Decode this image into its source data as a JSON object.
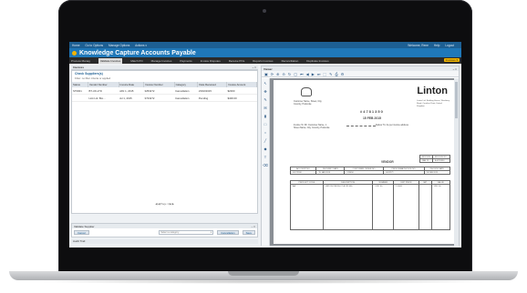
{
  "app": {
    "title": "Knowledge Capture Accounts Payable",
    "top_links": [
      "Home",
      "Go to Options",
      "Manage Options",
      "Actions ▾"
    ],
    "user_links": [
      "Welcome, Rene",
      "Help",
      "Logout"
    ]
  },
  "tabs": [
    {
      "label": "Process Manag"
    },
    {
      "label": "Validate Invoices",
      "active": true
    },
    {
      "label": "Match PO"
    },
    {
      "label": "Manage Invoices"
    },
    {
      "label": "Payments"
    },
    {
      "label": "Invoice Disputes"
    },
    {
      "label": "Receive POs"
    },
    {
      "label": "Reports Invoices"
    },
    {
      "label": "Reconciliation"
    },
    {
      "label": "Duplicate Invoices"
    }
  ],
  "tab_highlight": "Invoices ▾",
  "left_panel": {
    "header": "Invoices",
    "header_controls": "– □",
    "subtitle": "Check Suppliers(s)",
    "filter": "Filter: no filter criteria or applied",
    "columns": [
      "Status",
      "Vendor Number",
      "Invoice Date",
      "Invoice Number",
      "Category",
      "Date Received",
      "Invoice Amount"
    ],
    "rows": [
      [
        "ST0001",
        "BT-UK-LTD",
        "JAN 1, 2015",
        "3253272",
        "Cancellation",
        "23/02/2015",
        "$2000"
      ],
      [
        "",
        "Link Ltd. Bro...",
        "Jul 1, 2015",
        "3723272",
        "Cancellation",
        "Pending",
        "$400.00"
      ]
    ],
    "pager": "◀ ◀ Page 1 ▶ ▶"
  },
  "lower_panel": {
    "header": "Validate Supplier",
    "header_controls": "– □",
    "left_button": "Cancel",
    "select_placeholder": "Select a category",
    "action_button": "Cancellation",
    "save_button": "Save"
  },
  "audit_header": "Audit Trail",
  "viewer": {
    "header": "Viewer",
    "header_controls": "– □",
    "doc": {
      "brand": "Linton",
      "brand_sub": "Linton Ltd. Building House, Westbury Road, Carolina Paint, United Kingdom",
      "address": "Customer Name, Street, City, Country, Postcode",
      "invoice_no": "#4781350",
      "invoice_date": "15 FEB 2015",
      "invoice_to": "Invoice To: Mr. Customer Name, 1 Street Name, City, Country, Postcode",
      "deliver_to": "Deliver To: As per invoice address",
      "vendor_label": "VENDOR",
      "mini1": {
        "headers": [
          "INVOICE",
          "INVOICE NO."
        ],
        "values": [
          "JAN 15",
          "A 4781350"
        ]
      },
      "mini2": {
        "headers": [
          "ACCOUNT NO.",
          "DELIVERY DATE",
          "CUSTOMER ORDER NO.",
          "PROFORMA INVOICE NO.",
          "INVOICE DATE"
        ],
        "values": [
          "00172180",
          "15 JAN 2015",
          "123456",
          "0012271",
          "15 FEB 2015"
        ]
      },
      "mini3": {
        "headers": [
          "PRODUCT CODE",
          "DESCRIPTION",
          "NUMBER",
          "UNIT PRICE",
          "VAT",
          "VALUE"
        ],
        "values": [
          "AA",
          "LINTON PRODUCT A 123 456",
          "1237 00",
          "1.0000",
          "",
          "1237.00"
        ]
      }
    }
  }
}
